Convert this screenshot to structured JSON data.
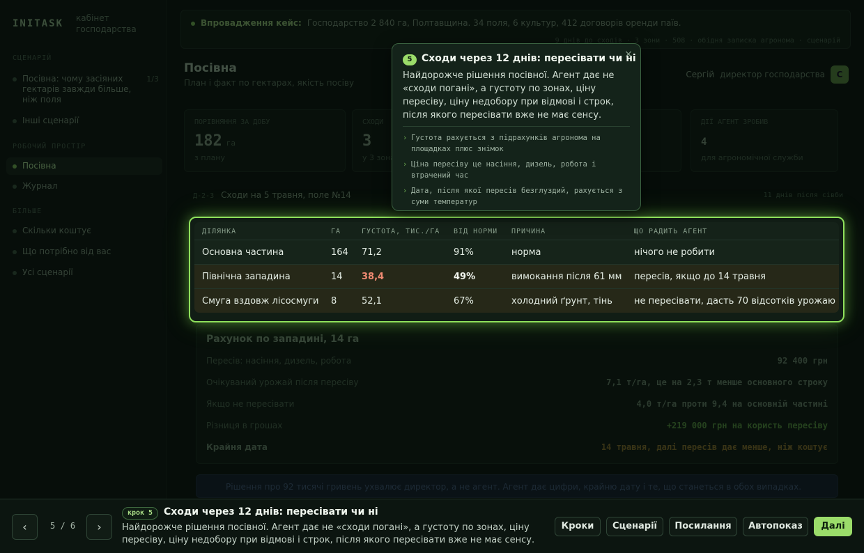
{
  "sidebar": {
    "brand": "INITASK",
    "brand_sub": "кабінет господарства",
    "section_scenario": "СЦЕНАРІЙ",
    "scenario_title": "Посівна: чому засіяних гектарів завжди більше, ніж поля",
    "scenario_count": "1/3",
    "other_scenarios": "Інші сценарії",
    "section_work": "РОБОЧИЙ ПРОСТІР",
    "item_sowing": "Посівна",
    "item_journal": "Журнал",
    "section_more": "БІЛЬШЕ",
    "item_cost": "Скільки коштує",
    "item_needs": "Що потрібно від вас",
    "item_all": "Усі сценарії"
  },
  "banner": {
    "label": "Впровадження кейс:",
    "text": "Господарство 2 840 га, Полтавщина. 34 поля, 6 культур, 412 договорів оренди паїв.",
    "meta": "9 днів до сходів · 3 зони · 508 · обідня записка агронома · сценарій"
  },
  "page": {
    "title": "Посівна",
    "subtitle": "План і факт по гектарах, якість посіву",
    "user_name": "Сергій",
    "user_role": "директор господарства",
    "avatar_letter": "С"
  },
  "stats": [
    {
      "label": "ПОРІВНЯННЯ ЗА ДОБУ",
      "value": "182",
      "unit": "га",
      "note": "з плану"
    },
    {
      "label": "СХОДИ",
      "value": "3",
      "unit": "",
      "note": "у 3 зонах"
    },
    {
      "label": "",
      "value": "",
      "unit": "",
      "note": ""
    },
    {
      "label": "ДІЇ АГЕНТ ЗРОБИВ",
      "value": "4",
      "unit": "",
      "note": "для агрономічної служби"
    }
  ],
  "crumb": {
    "prefix": "Д-2-3",
    "text": "Сходи на 5 травня, поле №14",
    "right": "11 днів після сівби"
  },
  "table": {
    "headers": [
      "ДІЛЯНКА",
      "ГА",
      "ГУСТОТА, ТИС./ГА",
      "ВІД НОРМИ",
      "ПРИЧИНА",
      "ЩО РАДИТЬ АГЕНТ"
    ],
    "rows": [
      {
        "plot": "Основна частина",
        "ha": "164",
        "density": "71,2",
        "norm": "91%",
        "reason": "норма",
        "advice": "нічого не робити"
      },
      {
        "plot": "Північна западина",
        "ha": "14",
        "density": "38,4",
        "norm": "49%",
        "reason": "вимокання після 61 мм",
        "advice": "пересів, якщо до 14 травня"
      },
      {
        "plot": "Смуга вздовж лісосмуги",
        "ha": "8",
        "density": "52,1",
        "norm": "67%",
        "reason": "холодний ґрунт, тінь",
        "advice": "не пересівати, дасть 70 відсотків урожаю"
      }
    ]
  },
  "calc": {
    "title": "Рахунок по западині, 14 га",
    "rows": [
      {
        "k": "Пересів: насіння, дизель, робота",
        "v": "92 400 грн"
      },
      {
        "k": "Очікуваний урожай після пересіву",
        "v": "7,1 т/га, це на 2,3 т менше основного строку"
      },
      {
        "k": "Якщо не пересівати",
        "v": "4,0 т/га проти 9,4 на основній частині"
      },
      {
        "k": "Різниця в грошах",
        "v": "+219 000 грн на користь пересіву"
      },
      {
        "k": "Крайня дата",
        "v": "14 травня, далі пересів дає менше, ніж коштує"
      }
    ]
  },
  "note_box": "Рішення про 92 тисячі гривень ухвалює директор, а не агент. Агент дає цифри, крайню дату і те, що станеться в обох випадках.",
  "popover": {
    "step": "5",
    "title": "Сходи через 12 днів: пересівати чи ні",
    "close": "×",
    "body": "Найдорожче рішення посівної. Агент дає не «сходи погані», а густоту по зонах, ціну пересіву, ціну недобору при відмові і строк, після якого пересівати вже не має сенсу.",
    "points": [
      "Густота рахується з підрахунків агронома на площадках плюс знімок",
      "Ціна пересіву це насіння, дизель, робота і втрачений час",
      "Дата, після якої пересів безглуздий, рахується з суми температур"
    ]
  },
  "tour": {
    "prev": "‹",
    "next": "›",
    "counter": "5 / 6",
    "chip": "крок 5",
    "title": "Сходи через 12 днів: пересівати чи ні",
    "desc": "Найдорожче рішення посівної. Агент дає не «сходи погані», а густоту по зонах, ціну пересіву, ціну недобору при відмові і строк, після якого пересівати вже не має сенсу.",
    "btn_steps": "Кроки",
    "btn_scenarios": "Сценарії",
    "btn_links": "Посилання",
    "btn_autoplay": "Автопоказ",
    "btn_next": "Далі"
  },
  "colors": {
    "accent": "#9bdc6a",
    "highlight_border": "#8fe05c",
    "danger_value": "#f08a72"
  }
}
